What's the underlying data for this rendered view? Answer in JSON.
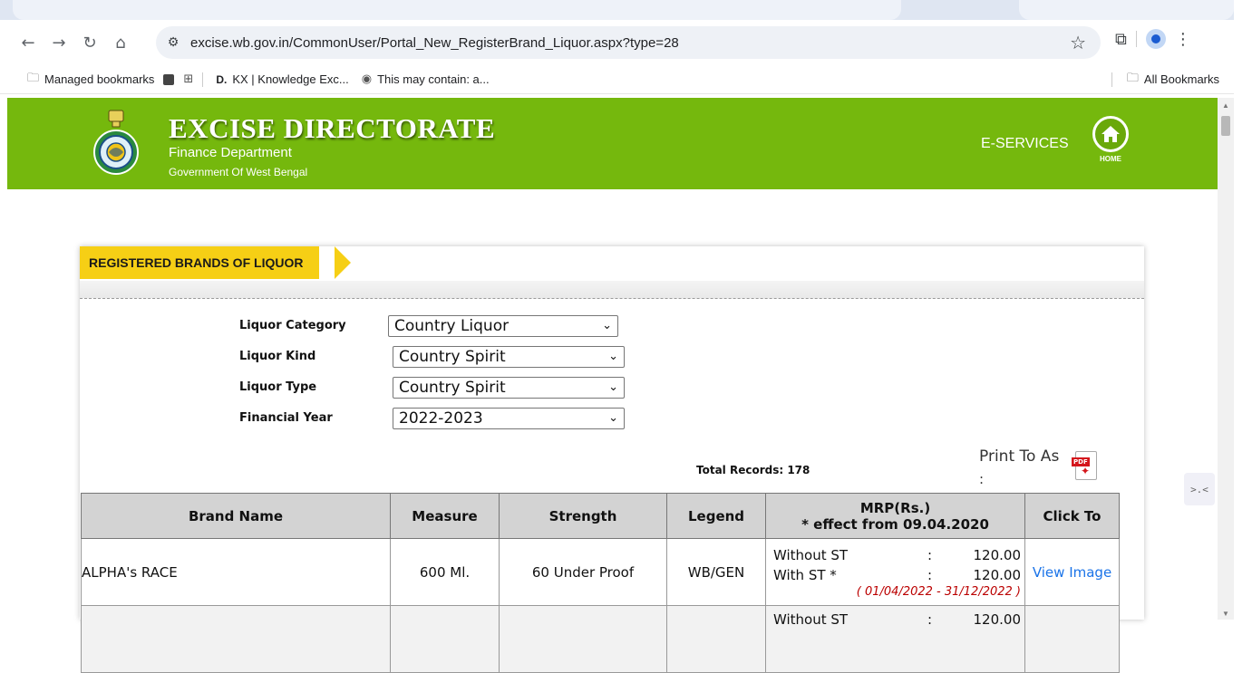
{
  "browser": {
    "url": "excise.wb.gov.in/CommonUser/Portal_New_RegisterBrand_Liquor.aspx?type=28",
    "bookmarks": [
      {
        "label": "Managed bookmarks"
      },
      {
        "label": "KX | Knowledge Exc..."
      },
      {
        "label": "This may contain: a..."
      }
    ],
    "all_bookmarks": "All Bookmarks"
  },
  "header": {
    "title": "EXCISE DIRECTORATE",
    "department": "Finance Department",
    "government": "Government Of West Bengal",
    "eservices": "E-SERVICES",
    "home_label": "HOME",
    "brand_color": "#75b80d"
  },
  "panel": {
    "heading": "REGISTERED BRANDS OF LIQUOR",
    "filters": [
      {
        "label": "Liquor Category",
        "value": "Country Liquor"
      },
      {
        "label": "Liquor Kind",
        "value": "Country Spirit"
      },
      {
        "label": "Liquor Type",
        "value": "Country Spirit"
      },
      {
        "label": "Financial Year",
        "value": "2022-2023"
      }
    ],
    "total_records": "Total Records: 178",
    "print_label": "Print To As",
    "print_colon": ":",
    "pdf_tag": "PDF"
  },
  "table": {
    "headers": {
      "brand": "Brand Name",
      "measure": "Measure",
      "strength": "Strength",
      "legend": "Legend",
      "mrp_line1": "MRP(Rs.)",
      "mrp_line2": "* effect from 09.04.2020",
      "click": "Click To"
    },
    "rows": [
      {
        "brand": "ALPHA's RACE",
        "measure": "600 Ml.",
        "strength": "60 Under Proof",
        "legend": "WB/GEN",
        "without_st_label": "Without ST",
        "without_st": "120.00",
        "with_st_label": "With ST *",
        "with_st": "120.00",
        "period": "( 01/04/2022 - 31/12/2022 )",
        "action": "View Image"
      },
      {
        "brand": "",
        "measure": "",
        "strength": "",
        "legend": "",
        "without_st_label": "Without ST",
        "without_st": "120.00",
        "with_st_label": "",
        "with_st": "",
        "period": "",
        "action": ""
      }
    ]
  }
}
